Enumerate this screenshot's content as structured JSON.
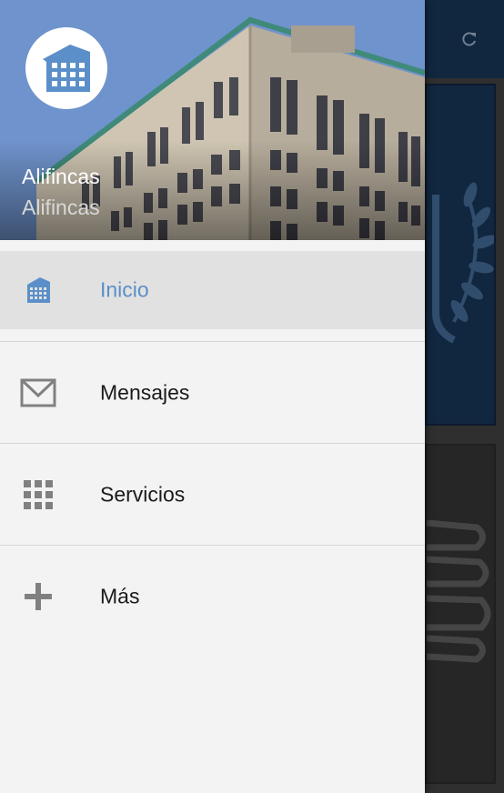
{
  "drawer": {
    "account_name": "Alifincas",
    "account_sub": "Alifincas",
    "items": [
      {
        "label": "Inicio",
        "icon": "building-icon",
        "active": true
      },
      {
        "label": "Mensajes",
        "icon": "mail-icon",
        "active": false
      },
      {
        "label": "Servicios",
        "icon": "grid-icon",
        "active": false
      },
      {
        "label": "Más",
        "icon": "plus-icon",
        "active": false
      }
    ]
  },
  "colors": {
    "accent": "#5b8fc9",
    "toolbar": "#15304d",
    "drawer_bg": "#f3f3f3",
    "active_row": "#e1e1e1"
  }
}
